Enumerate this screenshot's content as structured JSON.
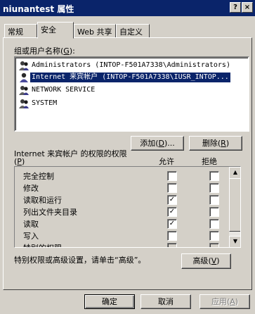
{
  "window": {
    "title": "niunantest 属性",
    "help_button": "?",
    "close_button": "×"
  },
  "tabs": [
    {
      "label": "常规"
    },
    {
      "label": "安全"
    },
    {
      "label": "Web 共享"
    },
    {
      "label": "自定义"
    }
  ],
  "users_group": {
    "label": "组或用户名称",
    "accel": "G",
    "users": [
      {
        "name": "Administrators (INTOP-F501A7338\\Administrators)"
      },
      {
        "name": "Internet 来宾帐户 (INTOP-F501A7338\\IUSR_INTOP..."
      },
      {
        "name": "NETWORK SERVICE"
      },
      {
        "name": "SYSTEM"
      }
    ]
  },
  "buttons": {
    "add": {
      "label": "添加",
      "accel": "D"
    },
    "remove": {
      "label": "删除",
      "accel": "R"
    },
    "advanced": {
      "label": "高级",
      "accel": "V"
    },
    "ok": "确定",
    "cancel": "取消",
    "apply": {
      "label": "应用",
      "accel": "A"
    }
  },
  "permissions": {
    "title": "Internet 来宾帐户 的权限",
    "title_accel": "P",
    "allow_header": "允许",
    "deny_header": "拒绝",
    "rows": [
      {
        "label": "完全控制",
        "allow": "",
        "deny": ""
      },
      {
        "label": "修改",
        "allow": "",
        "deny": ""
      },
      {
        "label": "读取和运行",
        "allow": "✓",
        "deny": ""
      },
      {
        "label": "列出文件夹目录",
        "allow": "✓",
        "deny": ""
      },
      {
        "label": "读取",
        "allow": "✓",
        "deny": ""
      },
      {
        "label": "写入",
        "allow": "",
        "deny": ""
      },
      {
        "label": "特别的权限",
        "allow": "",
        "deny": ""
      }
    ],
    "scrollbar": {
      "up_icon": "▲",
      "down_icon": "▼"
    }
  },
  "advanced_hint": "特别权限或高级设置，请单击“高级”。"
}
